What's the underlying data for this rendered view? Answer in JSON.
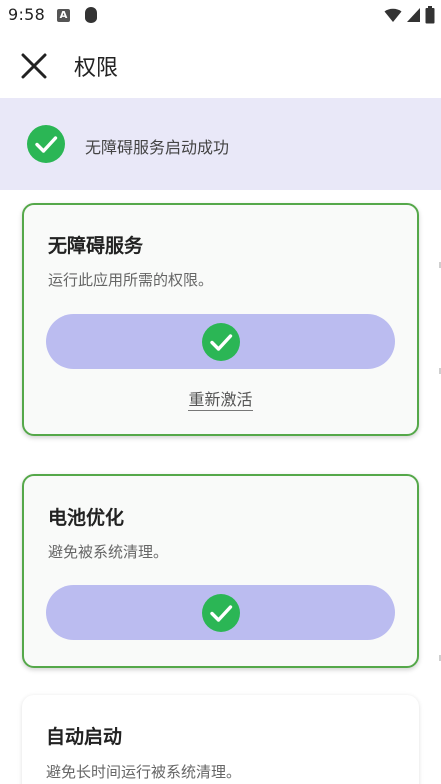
{
  "status_bar": {
    "time": "9:58",
    "notification_letter": "A",
    "icons": [
      "a-notification-icon",
      "shield-icon",
      "wifi-icon",
      "signal-icon",
      "battery-icon"
    ]
  },
  "app_bar": {
    "title": "权限",
    "close_icon": "close-icon"
  },
  "banner": {
    "text": "无障碍服务启动成功",
    "icon": "check-circle-icon"
  },
  "cards": [
    {
      "title": "无障碍服务",
      "description": "运行此应用所需的权限。",
      "granted": true,
      "action_label": "重新激活"
    },
    {
      "title": "电池优化",
      "description": "避免被系统清理。",
      "granted": true
    },
    {
      "title": "自动启动",
      "description": "避免长时间运行被系统清理。"
    }
  ],
  "colors": {
    "banner_bg": "#e9e8f8",
    "card_border": "#55a84a",
    "pill_bg": "#bbbcf0",
    "check_green": "#2bb655"
  }
}
